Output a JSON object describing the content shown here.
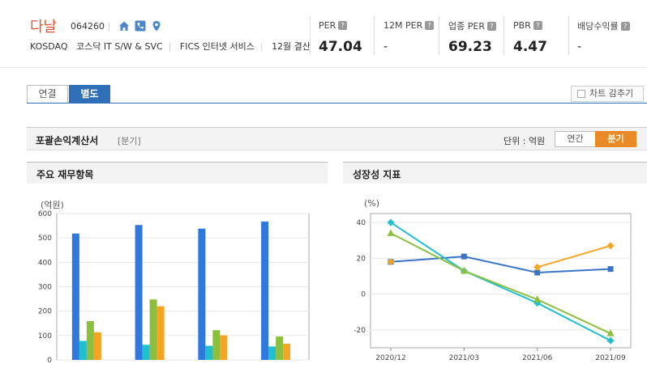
{
  "company": {
    "name": "다날",
    "code": "064260",
    "market": "KOSDAQ",
    "sector": "코스닥 IT S/W & SVC",
    "fics": "FICS 인터넷 서비스",
    "settlement": "12월 결산"
  },
  "metrics": [
    {
      "label": "PER",
      "value": "47.04"
    },
    {
      "label": "12M PER",
      "value": "-"
    },
    {
      "label": "업종 PER",
      "value": "69.23"
    },
    {
      "label": "PBR",
      "value": "4.47"
    },
    {
      "label": "배당수익률",
      "value": "-"
    }
  ],
  "tabs": {
    "consolidated": "연결",
    "separate": "별도"
  },
  "hide_chart": "차트 감추기",
  "section": {
    "title": "포괄손익계산서",
    "period": "[분기]",
    "unit": "단위 : 억원",
    "annual": "연간",
    "quarterly": "분기"
  },
  "panels": {
    "left": "주요 재무항목",
    "right": "성장성 지표"
  },
  "colors": {
    "blue": "#2f78dd",
    "cyan": "#1fbfd0",
    "green": "#8dbf3f",
    "orange": "#f4a523",
    "navy": "#3a73c4"
  },
  "chart_data": [
    {
      "type": "bar",
      "ylabel": "(억원)",
      "ylim": [
        0,
        600
      ],
      "yticks": [
        0,
        100,
        200,
        300,
        400,
        500,
        600
      ],
      "groups": 4,
      "series": [
        {
          "values": [
            518,
            553,
            538,
            567
          ]
        },
        {
          "values": [
            78,
            62,
            58,
            55
          ]
        },
        {
          "values": [
            159,
            248,
            122,
            96
          ]
        },
        {
          "values": [
            113,
            220,
            101,
            66
          ]
        }
      ]
    },
    {
      "type": "line",
      "ylabel": "(%)",
      "ylim": [
        -30,
        45
      ],
      "yticks": [
        -20,
        0,
        20,
        40
      ],
      "categories": [
        "2020/12",
        "2021/03",
        "2021/06",
        "2021/09"
      ],
      "series": [
        {
          "values": [
            18,
            21,
            12,
            14
          ]
        },
        {
          "values": [
            18,
            null,
            15,
            27
          ]
        },
        {
          "values": [
            40,
            13,
            -5,
            -26
          ]
        },
        {
          "values": [
            34,
            13,
            -3,
            -22
          ]
        }
      ]
    }
  ]
}
